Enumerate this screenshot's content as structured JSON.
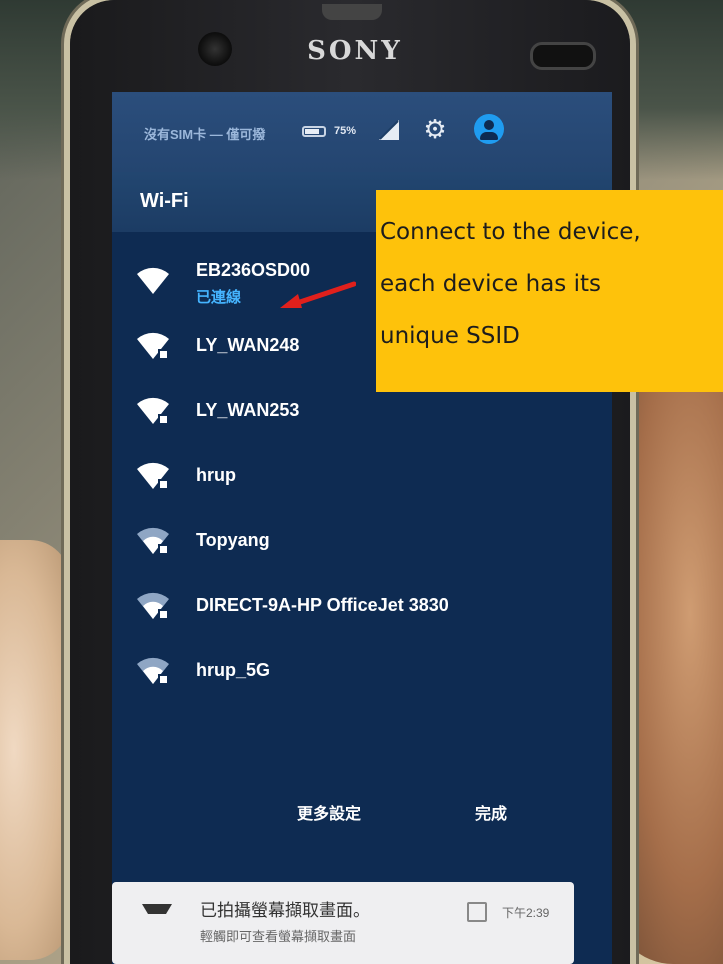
{
  "phone": {
    "brand": "SONY"
  },
  "status_bar": {
    "carrier_text": "沒有SIM卡 — 僅可撥",
    "battery_percent": "75%",
    "icons": [
      "battery-icon",
      "signal-icon",
      "gear-icon",
      "account-icon"
    ]
  },
  "wifi_panel": {
    "title": "Wi-Fi",
    "networks": [
      {
        "ssid": "EB236OSD00",
        "status": "已連線",
        "connected": true
      },
      {
        "ssid": "LY_WAN248",
        "status": "",
        "connected": false
      },
      {
        "ssid": "LY_WAN253",
        "status": "",
        "connected": false
      },
      {
        "ssid": "hrup",
        "status": "",
        "connected": false
      },
      {
        "ssid": "Topyang",
        "status": "",
        "connected": false
      },
      {
        "ssid": "DIRECT-9A-HP OfficeJet 3830",
        "status": "",
        "connected": false
      },
      {
        "ssid": "hrup_5G",
        "status": "",
        "connected": false
      }
    ],
    "more_settings_label": "更多設定",
    "done_label": "完成"
  },
  "notification": {
    "title": "已拍攝螢幕擷取畫面。",
    "subtitle": "輕觸即可查看螢幕擷取畫面",
    "time": "下午2:39"
  },
  "callout": {
    "lines": [
      "Connect to the device,",
      "each device has its",
      "unique SSID"
    ]
  },
  "colors": {
    "callout_bg": "#fec20b",
    "panel_bg": "#0e2b52",
    "connected_status": "#45b4ff",
    "arrow": "#e0201c",
    "account_icon": "#1f9cf0"
  }
}
